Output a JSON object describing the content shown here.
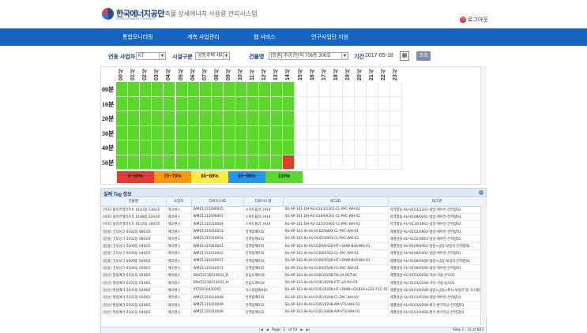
{
  "header": {
    "logo_name": "한국에너지공단",
    "logo_sub": "KOREA ENERGY AGENCY",
    "system_title": "건축물 상세에너지 사용량 관리시스템",
    "logout_label": "로그아웃"
  },
  "nav": {
    "items": [
      {
        "label": "통합모니터링"
      },
      {
        "label": "계측 사업관리"
      },
      {
        "label": "웹 서비스"
      },
      {
        "label": "연구사업단 지원"
      }
    ]
  },
  "filters": {
    "operator_label": "연동 사업자",
    "operator_value": "KT",
    "facility_label": "시설구분",
    "facility_value": "공동주택 세대",
    "building_label": "건물명",
    "building_value": "[등촌] 주공7단지 706동 306호",
    "period_label": "기간",
    "date_value": "2017-05-18",
    "search_label": "조회"
  },
  "grid": {
    "hours": [
      "00시",
      "01시",
      "02시",
      "03시",
      "04시",
      "05시",
      "06시",
      "07시",
      "08시",
      "09시",
      "10시",
      "11시",
      "12시",
      "13시",
      "14시",
      "15시",
      "16시",
      "17시",
      "18시",
      "19시",
      "20시",
      "21시",
      "22시",
      "23시"
    ],
    "minutes": [
      "00분",
      "10분",
      "20분",
      "30분",
      "40분",
      "50분"
    ],
    "filled_hours": 15,
    "red_cell": {
      "row": 5,
      "col": 14
    }
  },
  "legend": [
    {
      "label": "0~69%",
      "color": "#e53935"
    },
    {
      "label": "70~79%",
      "color": "#ff9800"
    },
    {
      "label": "80~89%",
      "color": "#ffeb3b"
    },
    {
      "label": "90~99%",
      "color": "#2196f3"
    },
    {
      "label": "100%",
      "color": "#5cd62c"
    }
  ],
  "colors": {
    "full": "#5cd62c",
    "low": "#e53935",
    "nav": "#1565c0"
  },
  "tag_panel": {
    "title": "실제 Tag 정보",
    "columns": [
      "건물명",
      "사업자",
      "디바이스ID",
      "디바이스명",
      "태그ID",
      "태그명"
    ],
    "rows": [
      [
        "[서초] 홍라키엘라트트 0103동 2301호",
        "에코센스",
        "WMZ1315090005",
        "스마트플러그A14",
        "SU-AP-101-DH-AU-0103/2301-CL-PAC-WH-02",
        "지역별동-AU-0103/2301-냉방-에어컨-전력량02"
      ],
      [
        "[서초] 홍라키엘라트트 0109동 0203호",
        "에코센스",
        "WMZ1315090001",
        "스마트플러그A14",
        "SU-AP-101-DH-AU-0109/0201-CL-PAC-WH-02",
        "지역별동-AU-0109/0201-냉방-에어컨-전력량01"
      ],
      [
        "[서초] 홍라키엘라트트 0110동 1602호",
        "에코센스",
        "WMZ1315010004",
        "스마트플러그A14",
        "SU-AP-101-DH-AU-0110/1602-CL-PAC-WH-02",
        "지역별동-AU-0110/1602-냉방-에어컨-전력량02"
      ],
      [
        "[잠실] 굿모닝크 0102동 0803호",
        "에코센스",
        "WMZ1315010053",
        "전력량계015",
        "SU-AP-102-IH-AU-0102/0803-CL-PAC-WH-01",
        "개별냉방-AU-0102/0803-냉방-에어컨-전력량01"
      ],
      [
        "[잠실] 굿모닝크 0102동 0803호",
        "에코센스",
        "WMZ1315010054",
        "전력량계015",
        "SU-AP-102-IH-AU-0102/0803-CL-PAC-WH-02",
        "개별냉방-AU-0102/0803-냉방-에어컨-전력량02"
      ],
      [
        "[잠실] 굿모닝크 0109동 0402호",
        "에코센스",
        "WMZ1315010041",
        "전력량계015",
        "SU-AP-102-IH-AU-0109/0402-HT+DHW-BLR-WH-01",
        "개별냉방-AU-0109/0402-냉방+급탕-보일러-전력량01"
      ],
      [
        "[잠실] 굿모닝크 0109동 0402호",
        "에코센스",
        "WMZ1315010042",
        "전력량계015",
        "SU-AP-102-IH-AU-0109/0402-CL-PAC-WH-01",
        "개별냉방-AU-0109/0402-냉방-에어컨-전력량01"
      ],
      [
        "[잠실] 굿모닝크 0109동 0506호",
        "에코센스",
        "WMZ1315010037",
        "전력량계015",
        "SU-AP-102-IH-AU-0109/0506-HT+DHW-BLR-WH-01",
        "개별냉방-AU-0109/0506-냉방+급탕-보일러-전력량01"
      ],
      [
        "[잠실] 굿모닝크 0109동 0506호",
        "에코센스",
        "WMZ1315010071",
        "전력량계015",
        "SU-AP-102-IH-AU-0109/0506-CL-PAC-WH-01",
        "개별냉방-AU-0109/0506-냉방-에어컨-전력량01"
      ],
      [
        "[당산] 쌍용예가 0101동 0208호",
        "에코센스",
        "ENVZ2116010032_D",
        "온습도계A19",
        "SU-AP-103-IH-AU-0101/0208-TH-LR-DST-01",
        "개별냉방-AU-0101/0208-기타-거실-온도01"
      ],
      [
        "[당산] 쌍용예가 0101동 0208호",
        "에코센스",
        "ENVZ2116010032_H",
        "온습도계A19",
        "SU-AP-103-IH-AU-0101/0208-ETC-LR-RH-01",
        "개별냉방-AU-0101/0208-기타-거실-습도01"
      ],
      [
        "[당산] 쌍용예가 0101동 0208호",
        "에코센스",
        "PTZ2016020265",
        "가스유량계A15",
        "SU-AP-103-IH-AU-0101/0208-HT+DHW+CK-BLR+GSC-FLC-01",
        "개별냉방-AU-0101/0208-냉방+급탕+취사-보일러 및 가스레인지-유량01"
      ],
      [
        "[당산] 쌍용예가 0101동 0208호",
        "에코센스",
        "WMZ1315010048",
        "전력량계015",
        "SU-AP-103-IH-AU-0101/0208-CL-PAC-WH-02",
        "개별냉방-AU-0101/0208-냉방-에어컨-전력량02"
      ],
      [
        "[당산] 쌍용예가 0101동 0208호",
        "에코센스",
        "WMZ1315010049",
        "전력량계015",
        "SU-AP-103-IH-AU-0101/0208-AM-VTU-WH-01",
        "개별냉방-AU-0101/0208-환기-환기유닛-전력량01"
      ],
      [
        "[당산] 쌍용예가 0101동 0408호",
        "에코센스",
        "WMZ1315010046",
        "전력량계015",
        "SU-AP-103-IH-AU-0101/0408-AM-VTU-WH-01",
        "개별냉방-AU-0101/0408-환기-환기유닛-전력량01"
      ]
    ],
    "pager": {
      "page_label": "Page",
      "page_value": "1",
      "of_label": "of 54",
      "view_info": "View 1 - 15 of 803"
    }
  }
}
